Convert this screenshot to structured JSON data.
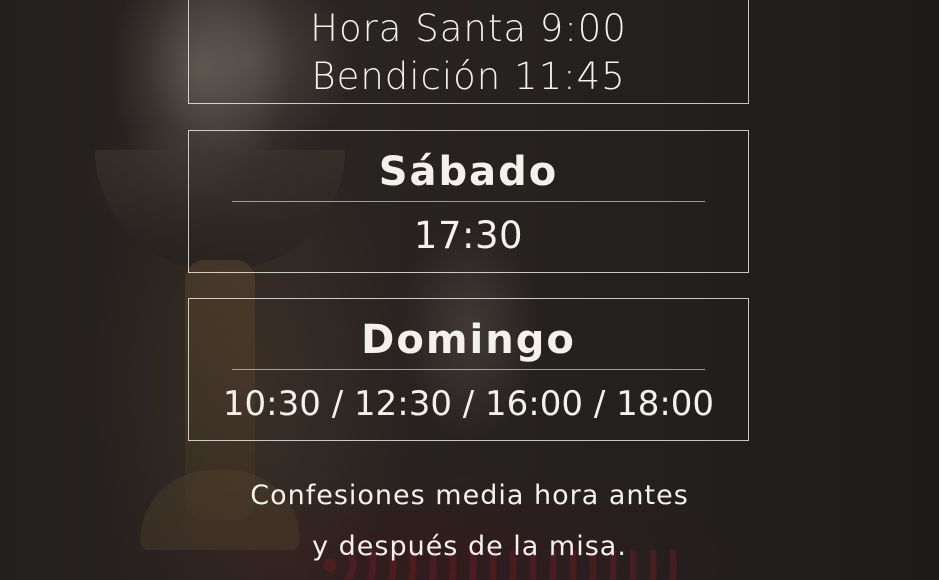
{
  "schedule": {
    "top_box": {
      "line_1": "Hora Santa 9:00",
      "line_2": "Bendición 11:45"
    },
    "saturday": {
      "title": "Sábado",
      "times": "17:30"
    },
    "sunday": {
      "title": "Domingo",
      "times": "10:30 / 12:30 / 16:00 / 18:00"
    }
  },
  "note": {
    "line_1": "Confesiones media hora antes",
    "line_2": "y después de la misa."
  },
  "colors": {
    "text": "#f4f1ec",
    "border": "#ffffff",
    "background": "#231f1d"
  }
}
